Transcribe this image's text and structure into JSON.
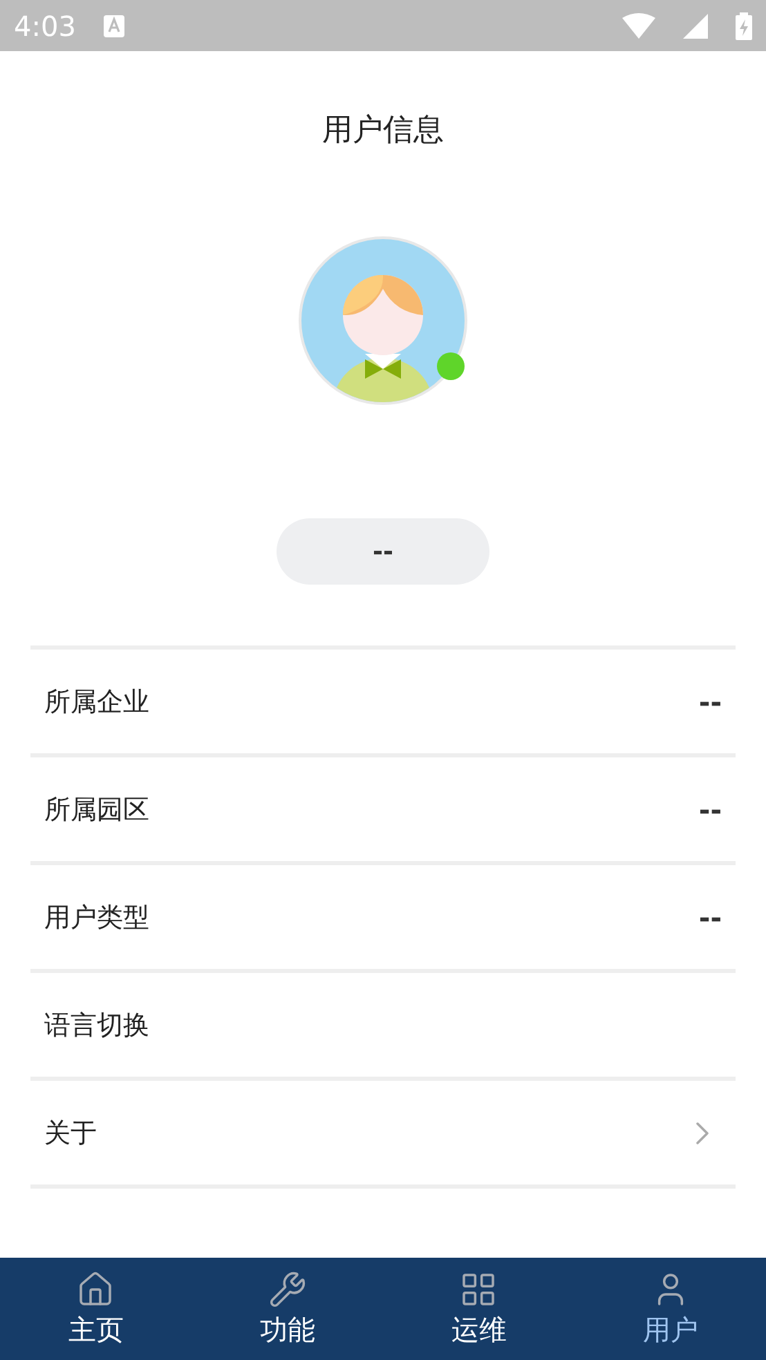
{
  "status_bar": {
    "time": "4:03"
  },
  "title": "用户信息",
  "user": {
    "online": true,
    "name": "--"
  },
  "rows": [
    {
      "label": "所属企业",
      "value": "--",
      "kind": "value"
    },
    {
      "label": "所属园区",
      "value": "--",
      "kind": "value"
    },
    {
      "label": "用户类型",
      "value": "--",
      "kind": "value"
    },
    {
      "label": "语言切换",
      "kind": "plain"
    },
    {
      "label": "关于",
      "kind": "link"
    }
  ],
  "tabs": [
    {
      "label": "主页",
      "kind": "home",
      "selected": false
    },
    {
      "label": "功能",
      "kind": "tools",
      "selected": false
    },
    {
      "label": "运维",
      "kind": "grid",
      "selected": false
    },
    {
      "label": "用户",
      "kind": "user",
      "selected": true
    }
  ]
}
